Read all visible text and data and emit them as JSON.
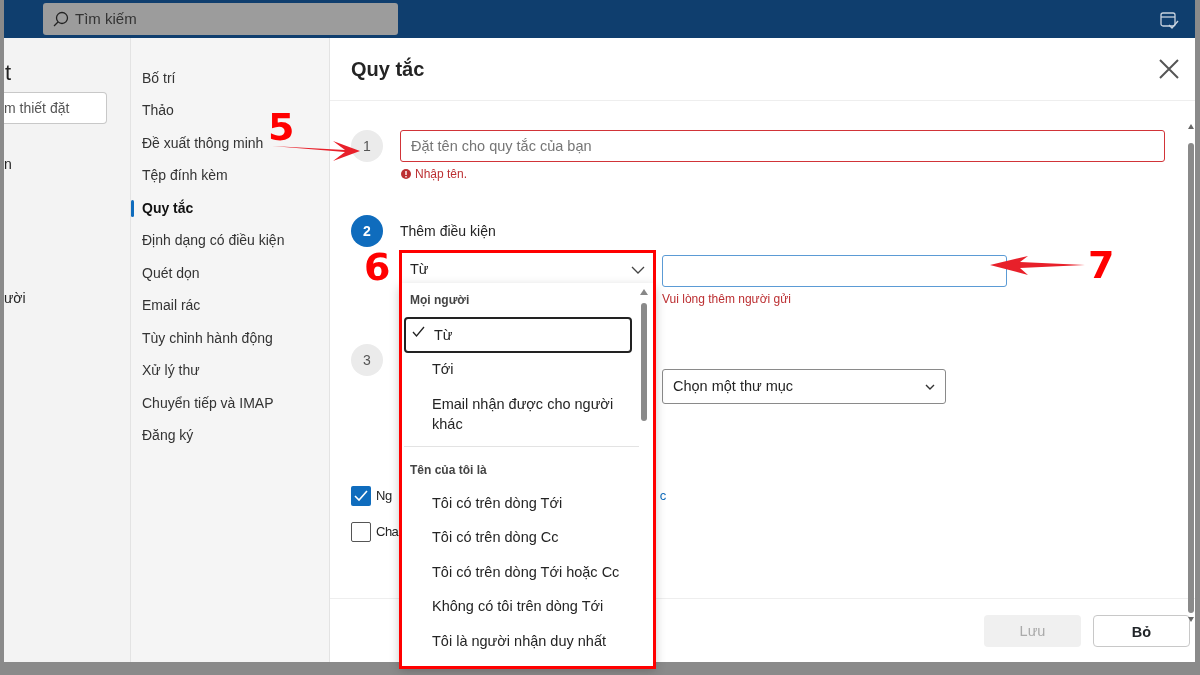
{
  "topbar": {
    "search_placeholder": "Tìm kiếm"
  },
  "settings_pane": {
    "title": "t",
    "search_placeholder": "m thiết đặt",
    "items": [
      {
        "label": "n"
      },
      {
        "label": "ười"
      }
    ]
  },
  "nav": [
    {
      "label": "Bố trí",
      "selected": false
    },
    {
      "label": "Thảo",
      "selected": false
    },
    {
      "label": "Đề xuất thông minh",
      "selected": false
    },
    {
      "label": "Tệp đính kèm",
      "selected": false
    },
    {
      "label": "Quy tắc",
      "selected": true
    },
    {
      "label": "Định dạng có điều kiện",
      "selected": false
    },
    {
      "label": "Quét dọn",
      "selected": false
    },
    {
      "label": "Email rác",
      "selected": false
    },
    {
      "label": "Tùy chỉnh hành động",
      "selected": false
    },
    {
      "label": "Xử lý thư",
      "selected": false
    },
    {
      "label": "Chuyển tiếp và IMAP",
      "selected": false
    },
    {
      "label": "Đăng ký",
      "selected": false
    }
  ],
  "dialog": {
    "title": "Quy tắc",
    "step1": {
      "number": "1",
      "placeholder": "Đặt tên cho quy tắc của bạn",
      "error": "Nhập tên."
    },
    "step2": {
      "number": "2",
      "title": "Thêm điều kiện",
      "condition": "Từ",
      "hint": "Vui lòng thêm người gửi"
    },
    "step3": {
      "number": "3",
      "folder": "Chọn một thư mục"
    },
    "checkboxes": [
      {
        "label": "Ng",
        "checked": true
      },
      {
        "label": "Cha",
        "checked": false
      }
    ],
    "link_fragment": "c",
    "buttons": [
      {
        "label": "Lưu",
        "disabled": true
      },
      {
        "label": "Bỏ",
        "disabled": false
      }
    ]
  },
  "dropdown": [
    {
      "header": "Mọi người",
      "items": [
        {
          "label": "Từ",
          "selected": true
        },
        {
          "label": "Tới",
          "selected": false
        },
        {
          "label": "Email nhận được cho người khác",
          "selected": false
        }
      ]
    },
    {
      "header": "Tên của tôi là",
      "items": [
        {
          "label": "Tôi có trên dòng Tới",
          "selected": false
        },
        {
          "label": "Tôi có trên dòng Cc",
          "selected": false
        },
        {
          "label": "Tôi có trên dòng Tới hoặc Cc",
          "selected": false
        },
        {
          "label": "Không có tôi trên dòng Tới",
          "selected": false
        },
        {
          "label": "Tôi là người nhận duy nhất",
          "selected": false
        }
      ]
    }
  ],
  "annotations": [
    {
      "kind": "arrow",
      "label": "5"
    },
    {
      "kind": "box",
      "label": "6"
    },
    {
      "kind": "arrow",
      "label": "7"
    }
  ]
}
